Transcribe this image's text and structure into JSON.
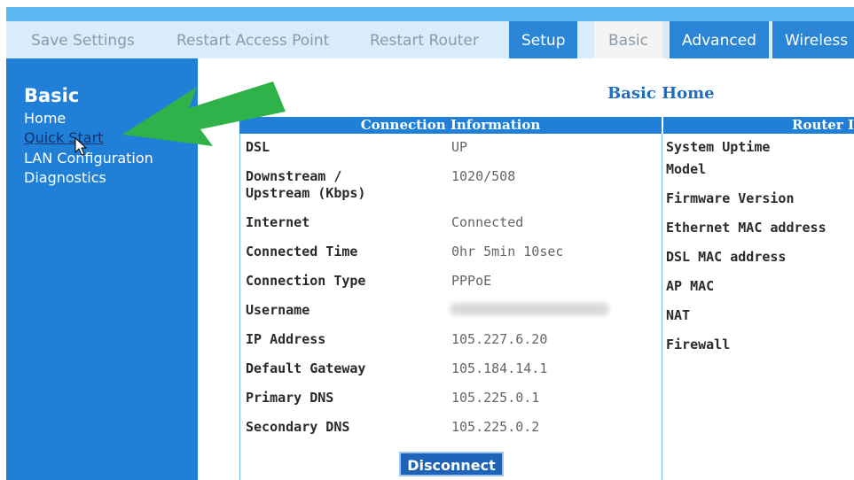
{
  "tabs": {
    "save_settings": "Save Settings",
    "restart_ap": "Restart Access Point",
    "restart_router": "Restart Router",
    "setup": "Setup",
    "basic": "Basic",
    "advanced": "Advanced",
    "wireless": "Wireless"
  },
  "sidebar": {
    "title": "Basic",
    "items": [
      {
        "label": "Home"
      },
      {
        "label": "Quick Start"
      },
      {
        "label": "LAN Configuration"
      },
      {
        "label": "Diagnostics"
      }
    ]
  },
  "main": {
    "heading": "Basic Home",
    "connection_header": "Connection Information",
    "router_header": "Router I",
    "connection_rows": [
      {
        "label": "DSL",
        "value": "UP"
      },
      {
        "label": "Downstream /",
        "label2": "Upstream (Kbps)",
        "value": "1020/508"
      },
      {
        "label": "Internet",
        "value": "Connected"
      },
      {
        "label": "Connected Time",
        "value": "0hr 5min 10sec"
      },
      {
        "label": "Connection Type",
        "value": "PPPoE"
      },
      {
        "label": "Username",
        "value": ""
      },
      {
        "label": "IP Address",
        "value": "105.227.6.20"
      },
      {
        "label": "Default Gateway",
        "value": "105.184.14.1"
      },
      {
        "label": "Primary DNS",
        "value": "105.225.0.1"
      },
      {
        "label": "Secondary DNS",
        "value": "105.225.0.2"
      }
    ],
    "router_rows": [
      {
        "label": "System Uptime"
      },
      {
        "label": "Model"
      },
      {
        "label": "Firmware Version"
      },
      {
        "label": "Ethernet MAC address"
      },
      {
        "label": "DSL MAC address"
      },
      {
        "label": "AP MAC"
      },
      {
        "label": "NAT"
      },
      {
        "label": "Firewall"
      }
    ],
    "disconnect_label": "Disconnect"
  },
  "colors": {
    "tab_blue": "#2b85d6",
    "sidebar_blue": "#2080d8",
    "heading_blue": "#1e6fc2",
    "annotation_arrow": "#2fb24a"
  },
  "icons": {
    "cursor": "mouse-pointer-icon",
    "annotation": "green-arrow-annotation"
  }
}
